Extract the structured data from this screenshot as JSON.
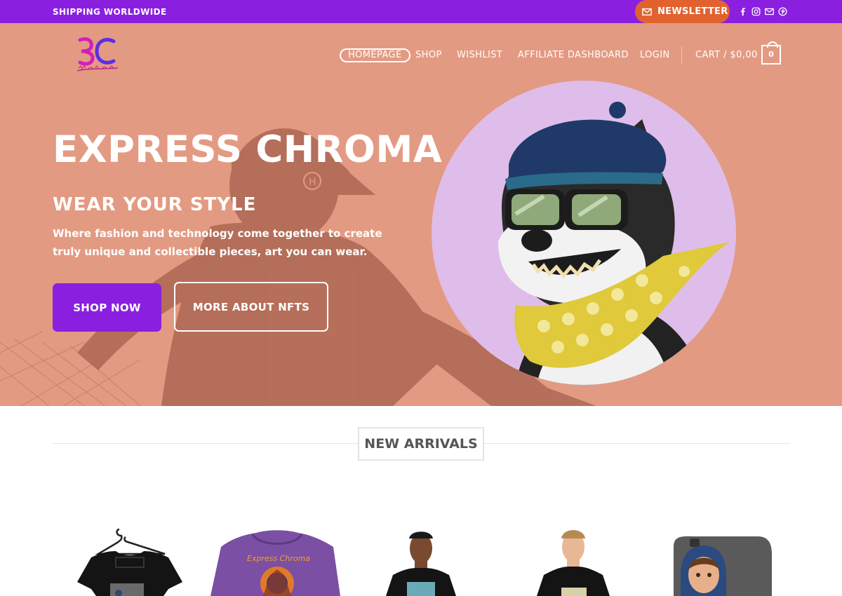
{
  "topbar": {
    "shipping_text": "SHIPPING WORLDWIDE",
    "newsletter_label": "NEWSLETTER",
    "social_icons": [
      "facebook-icon",
      "instagram-icon",
      "email-icon",
      "pinterest-icon"
    ]
  },
  "nav": {
    "items": [
      "HOMEPAGE",
      "SHOP",
      "WISHLIST",
      "AFFILIATE DASHBOARD",
      "LOGIN"
    ],
    "cart_label": "CART / $0,00",
    "cart_count": "0"
  },
  "hero": {
    "title": "EXPRESS CHROMA",
    "subtitle": "WEAR YOUR STYLE",
    "description": "Where fashion and technology come together to create truly unique and collectible pieces, art you can wear.",
    "primary_button": "SHOP NOW",
    "secondary_button": "MORE ABOUT NFTS"
  },
  "arrivals": {
    "heading": "NEW ARRIVALS"
  },
  "colors": {
    "brand_purple": "#8a1fe0",
    "newsletter_orange": "#e2622f",
    "hero_overlay": "#e39a82",
    "nft_circle": "#dfbdea"
  }
}
